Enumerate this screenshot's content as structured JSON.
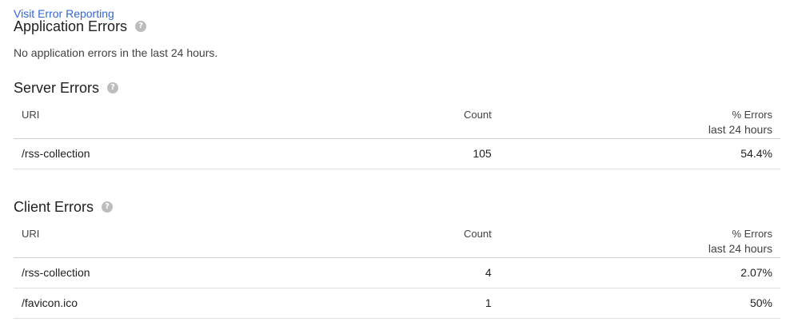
{
  "visit_link": "Visit Error Reporting",
  "application_errors": {
    "title": "Application Errors",
    "message": "No application errors in the last 24 hours."
  },
  "server_errors": {
    "title": "Server Errors",
    "columns": {
      "uri": "URI",
      "count": "Count",
      "pct": "% Errors",
      "pct_sub": "last 24 hours"
    },
    "rows": [
      {
        "uri": "/rss-collection",
        "count": "105",
        "pct": "54.4%"
      }
    ]
  },
  "client_errors": {
    "title": "Client Errors",
    "columns": {
      "uri": "URI",
      "count": "Count",
      "pct": "% Errors",
      "pct_sub": "last 24 hours"
    },
    "rows": [
      {
        "uri": "/rss-collection",
        "count": "4",
        "pct": "2.07%"
      },
      {
        "uri": "/favicon.ico",
        "count": "1",
        "pct": "50%"
      }
    ]
  },
  "icons": {
    "help": "help-circle-icon"
  }
}
